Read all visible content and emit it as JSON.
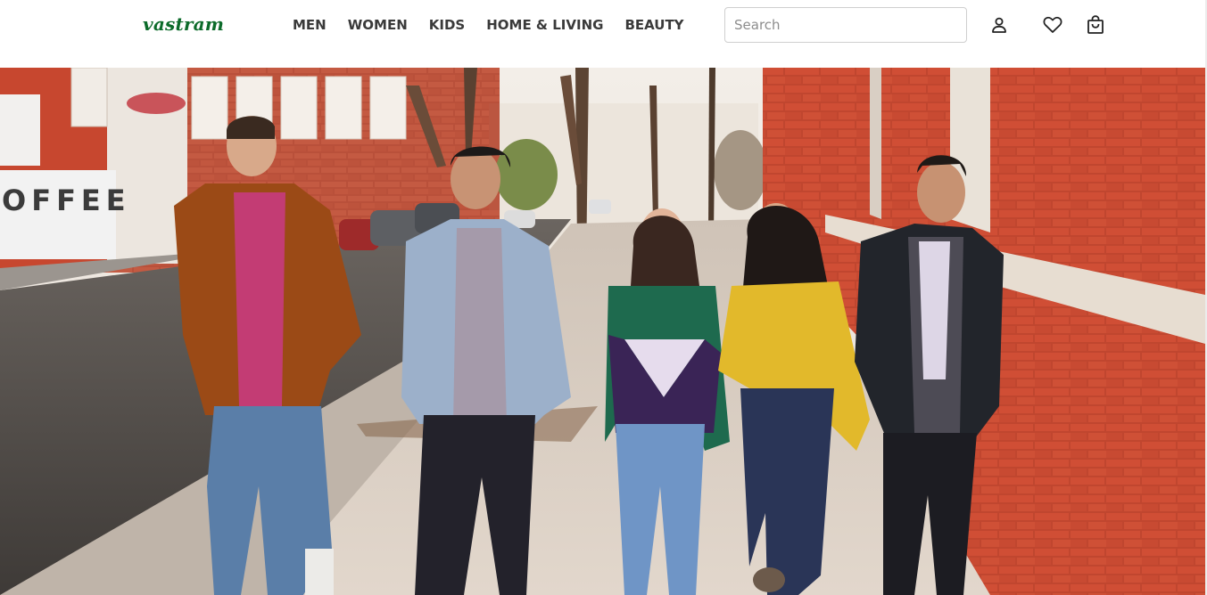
{
  "brand": {
    "logo_text": "vastram",
    "brand_color": "#0c6b2a"
  },
  "nav": {
    "items": [
      {
        "label": "MEN"
      },
      {
        "label": "WOMEN"
      },
      {
        "label": "KIDS"
      },
      {
        "label": "HOME & LIVING"
      },
      {
        "label": "BEAUTY"
      }
    ]
  },
  "search": {
    "placeholder": "Search",
    "value": ""
  },
  "header_icons": [
    {
      "name": "profile-icon"
    },
    {
      "name": "heart-icon"
    },
    {
      "name": "shopping-bag-icon"
    }
  ],
  "hero": {
    "sign_text": "OFFEE",
    "alt": "Five friends walking on a city sidewalk"
  }
}
